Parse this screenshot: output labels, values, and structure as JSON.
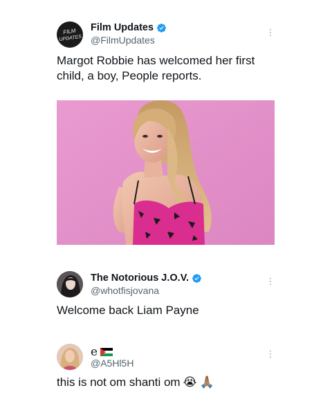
{
  "tweets": [
    {
      "name": "Film Updates",
      "handle": "@FilmUpdates",
      "verified": true,
      "text": "Margot Robbie has welcomed her first child, a boy, People reports.",
      "avatar_text": "FILM UPDATES",
      "has_media": true
    },
    {
      "name": "The Notorious J.O.V.",
      "handle": "@whotfisjovana",
      "verified": true,
      "text": "Welcome back Liam Payne"
    },
    {
      "name": "e",
      "name_flag": "palestine-flag-icon",
      "handle": "@A5Hl5H",
      "verified": false,
      "text": "this is not om shanti om",
      "emojis": [
        "😭",
        "🙏🏽"
      ]
    }
  ],
  "icons": {
    "verified": "verified-badge-icon",
    "more": "more-options-icon"
  },
  "colors": {
    "verified_blue": "#1d9bf0",
    "handle_gray": "#536471",
    "media_background": "#e58ec6"
  },
  "more_glyph": "⋮"
}
